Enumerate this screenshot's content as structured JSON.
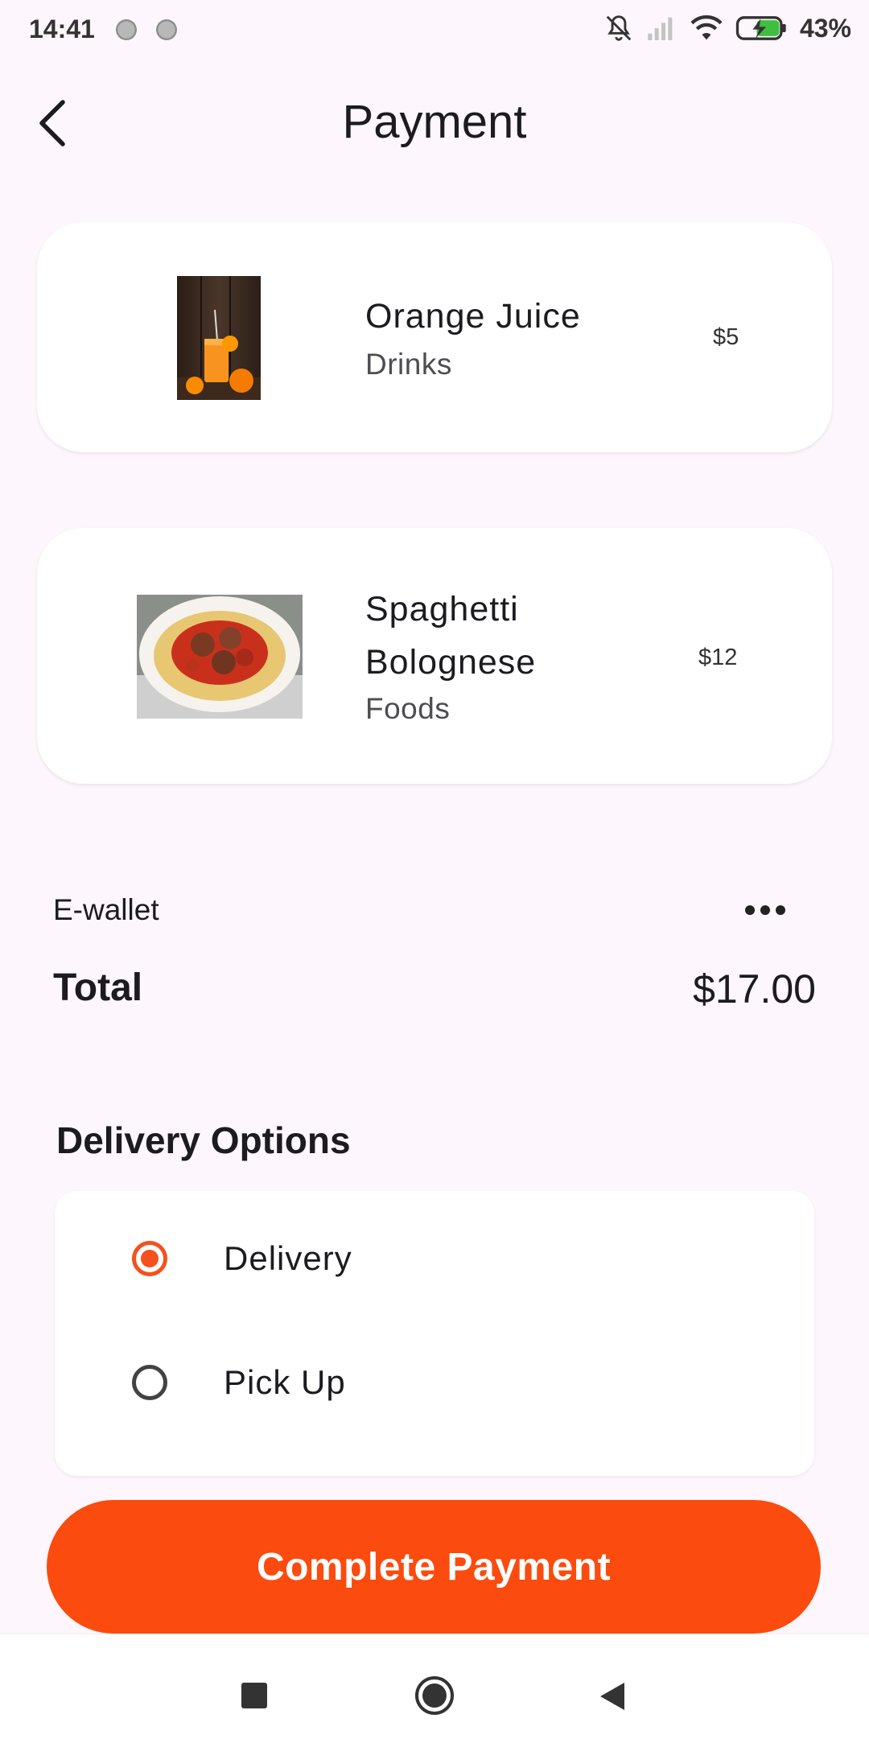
{
  "status_bar": {
    "time": "14:41",
    "battery": "43%"
  },
  "header": {
    "title": "Payment"
  },
  "items": [
    {
      "name": "Orange Juice",
      "category": "Drinks",
      "price": "$5"
    },
    {
      "name": "Spaghetti Bolognese",
      "name_line1": "Spaghetti",
      "name_line2": "Bolognese",
      "category": "Foods",
      "price": "$12"
    }
  ],
  "payment": {
    "method": "E-wallet",
    "total_label": "Total",
    "total_value": "$17.00"
  },
  "delivery": {
    "title": "Delivery Options",
    "options": [
      {
        "label": "Delivery",
        "selected": true
      },
      {
        "label": "Pick Up",
        "selected": false
      }
    ]
  },
  "actions": {
    "complete_label": "Complete Payment"
  },
  "colors": {
    "accent": "#fb4b0e",
    "background": "#fdf6fc"
  }
}
